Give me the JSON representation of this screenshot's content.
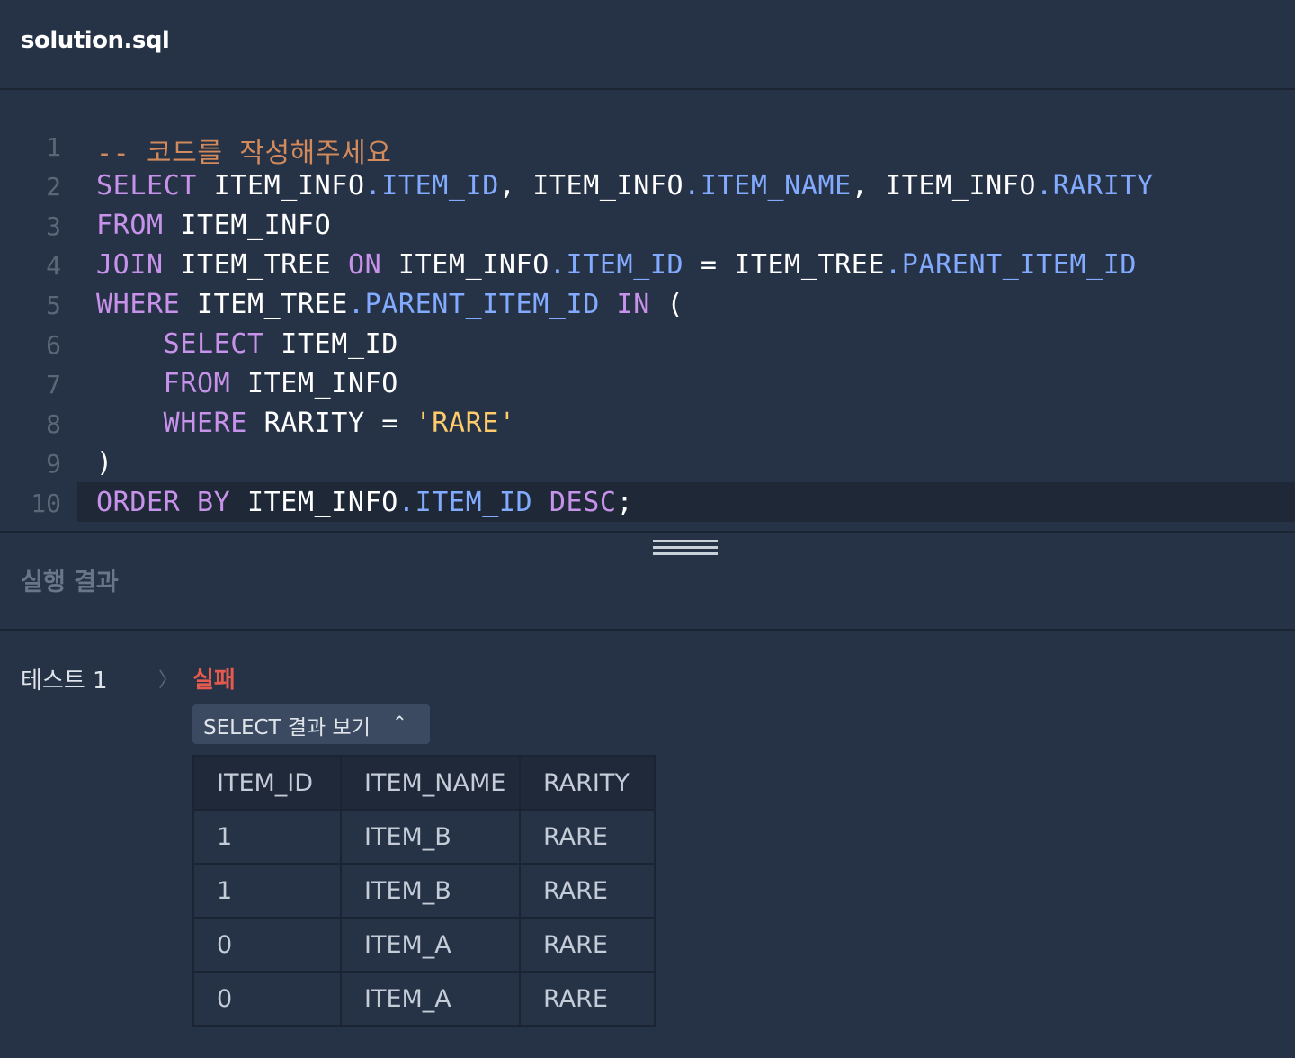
{
  "editor": {
    "filename": "solution.sql",
    "lines": [
      {
        "num": "1",
        "tokens": [
          {
            "t": "-- 코드를 작성해주세요",
            "c": "cmt"
          }
        ]
      },
      {
        "num": "2",
        "tokens": [
          {
            "t": "SELECT",
            "c": "kw"
          },
          {
            "t": " ITEM_INFO",
            "c": ""
          },
          {
            "t": ".ITEM_ID",
            "c": "fld"
          },
          {
            "t": ", ITEM_INFO",
            "c": ""
          },
          {
            "t": ".ITEM_NAME",
            "c": "fld"
          },
          {
            "t": ", ITEM_INFO",
            "c": ""
          },
          {
            "t": ".RARITY",
            "c": "fld"
          }
        ]
      },
      {
        "num": "3",
        "tokens": [
          {
            "t": "FROM",
            "c": "kw"
          },
          {
            "t": " ITEM_INFO",
            "c": ""
          }
        ]
      },
      {
        "num": "4",
        "tokens": [
          {
            "t": "JOIN",
            "c": "kw"
          },
          {
            "t": " ITEM_TREE ",
            "c": ""
          },
          {
            "t": "ON",
            "c": "kw"
          },
          {
            "t": " ITEM_INFO",
            "c": ""
          },
          {
            "t": ".ITEM_ID",
            "c": "fld"
          },
          {
            "t": " = ITEM_TREE",
            "c": ""
          },
          {
            "t": ".PARENT_ITEM_ID",
            "c": "fld"
          }
        ]
      },
      {
        "num": "5",
        "tokens": [
          {
            "t": "WHERE",
            "c": "kw"
          },
          {
            "t": " ITEM_TREE",
            "c": ""
          },
          {
            "t": ".PARENT_ITEM_ID",
            "c": "fld"
          },
          {
            "t": " ",
            "c": ""
          },
          {
            "t": "IN",
            "c": "kw"
          },
          {
            "t": " (",
            "c": ""
          }
        ]
      },
      {
        "num": "6",
        "tokens": [
          {
            "t": "    ",
            "c": ""
          },
          {
            "t": "SELECT",
            "c": "kw"
          },
          {
            "t": " ITEM_ID",
            "c": ""
          }
        ]
      },
      {
        "num": "7",
        "tokens": [
          {
            "t": "    ",
            "c": ""
          },
          {
            "t": "FROM",
            "c": "kw"
          },
          {
            "t": " ITEM_INFO",
            "c": ""
          }
        ]
      },
      {
        "num": "8",
        "tokens": [
          {
            "t": "    ",
            "c": ""
          },
          {
            "t": "WHERE",
            "c": "kw"
          },
          {
            "t": " RARITY = ",
            "c": ""
          },
          {
            "t": "'RARE'",
            "c": "str"
          }
        ]
      },
      {
        "num": "9",
        "tokens": [
          {
            "t": ")",
            "c": ""
          }
        ]
      },
      {
        "num": "10",
        "tokens": [
          {
            "t": "ORDER BY",
            "c": "kw"
          },
          {
            "t": " ITEM_INFO",
            "c": ""
          },
          {
            "t": ".ITEM_ID",
            "c": "fld"
          },
          {
            "t": " ",
            "c": ""
          },
          {
            "t": "DESC",
            "c": "kw"
          },
          {
            "t": ";",
            "c": ""
          }
        ]
      }
    ],
    "active_line": "10"
  },
  "result": {
    "title": "실행 결과",
    "test_label": "테스트 1",
    "status": "실패",
    "toggle_label": "SELECT 결과 보기",
    "columns": [
      "ITEM_ID",
      "ITEM_NAME",
      "RARITY"
    ],
    "rows": [
      [
        "1",
        "ITEM_B",
        "RARE"
      ],
      [
        "1",
        "ITEM_B",
        "RARE"
      ],
      [
        "0",
        "ITEM_A",
        "RARE"
      ],
      [
        "0",
        "ITEM_A",
        "RARE"
      ]
    ]
  },
  "colors": {
    "background": "#263245",
    "keyword": "#c792ea",
    "field": "#82aaff",
    "string": "#ffcb6b",
    "comment": "#d28a5c",
    "fail": "#e55a4e"
  },
  "icons": {
    "chevron": "chevron-right-icon",
    "caret": "chevron-up-icon",
    "handle": "drag-handle-icon"
  }
}
